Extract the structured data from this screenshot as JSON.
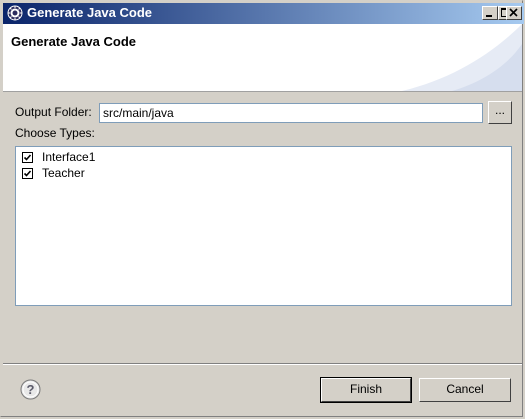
{
  "window": {
    "title": "Generate Java Code",
    "icon": "eclipse-icon"
  },
  "header": {
    "title": "Generate Java Code"
  },
  "form": {
    "output_folder_label": "Output Folder:",
    "output_folder_value": "src/main/java",
    "browse_label": "...",
    "choose_types_label": "Choose Types:"
  },
  "types": [
    {
      "label": "Interface1",
      "checked": true
    },
    {
      "label": "Teacher",
      "checked": true
    }
  ],
  "footer": {
    "help_icon": "help-icon",
    "finish_label": "Finish",
    "cancel_label": "Cancel"
  },
  "colors": {
    "titlebar_start": "#0a246a",
    "titlebar_end": "#a6caf0",
    "dialog_bg": "#d4d0c8"
  }
}
